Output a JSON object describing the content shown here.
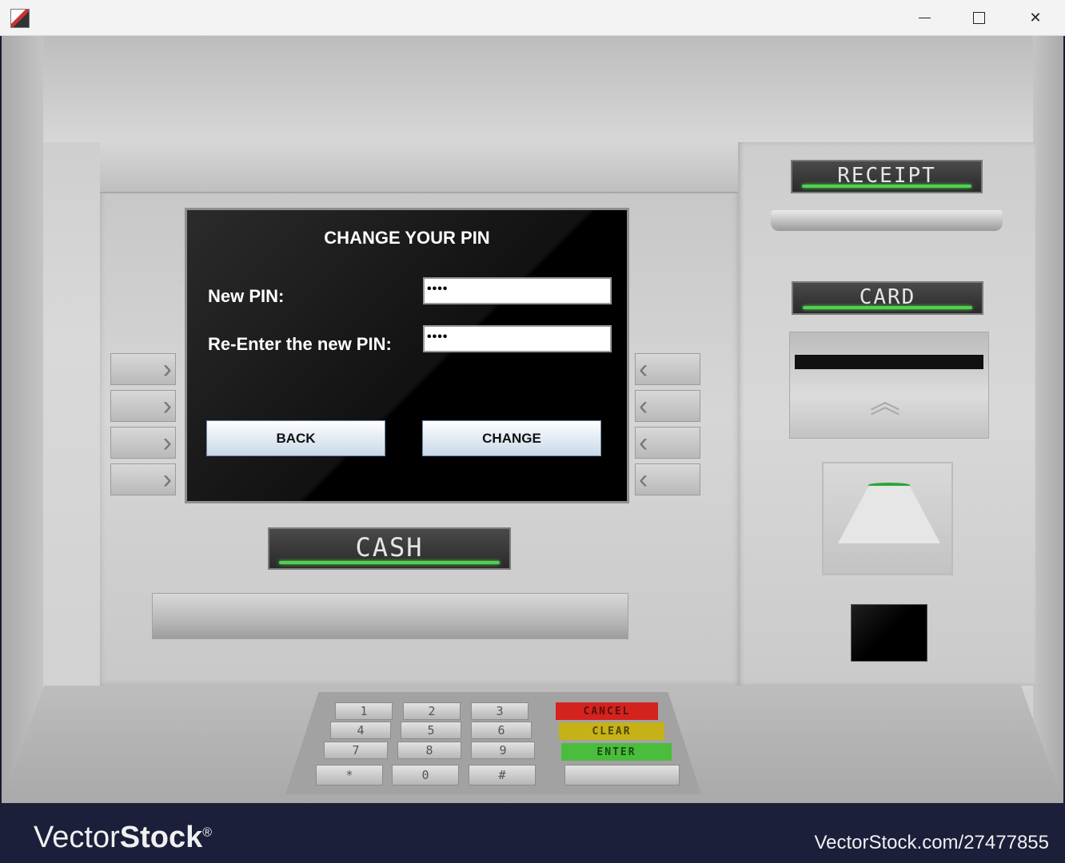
{
  "window": {
    "minimize": "—",
    "maximize": "☐",
    "close": "✕"
  },
  "screen": {
    "title": "CHANGE YOUR PIN",
    "new_pin_label": "New PIN:",
    "new_pin_value": "••••",
    "reenter_label": "Re-Enter the new PIN:",
    "reenter_value": "••••",
    "back_label": "BACK",
    "change_label": "CHANGE"
  },
  "side_keys": {
    "left_glyph": "›",
    "right_glyph": "‹"
  },
  "labels": {
    "cash": "CASH",
    "receipt": "RECEIPT",
    "card": "CARD"
  },
  "card_reader": {
    "chevron": "︽"
  },
  "keypad": {
    "digits": [
      "1",
      "2",
      "3",
      "4",
      "5",
      "6",
      "7",
      "8",
      "9",
      "*",
      "0",
      "#"
    ],
    "cancel": "CANCEL",
    "clear": "CLEAR",
    "enter": "ENTER"
  },
  "watermark": {
    "logo_thin": "Vector",
    "logo_bold": "Stock",
    "logo_mark": "®",
    "url": "VectorStock.com/27477855"
  },
  "colors": {
    "glow": "#4fd14f",
    "cancel": "#d4231e",
    "clear": "#c6b116",
    "enter": "#4bbd3c"
  }
}
